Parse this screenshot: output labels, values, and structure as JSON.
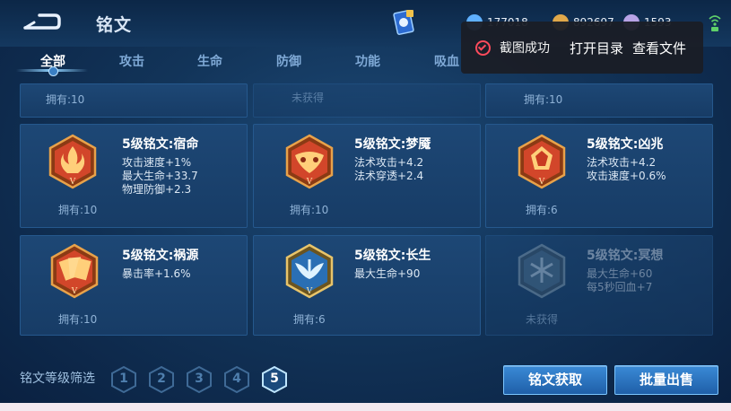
{
  "header": {
    "title": "铭文",
    "resources": [
      {
        "icon": "diamond-icon",
        "value": "177018",
        "color": "#5fb0ff"
      },
      {
        "icon": "gold-coin-icon",
        "value": "892697",
        "color": "#e0a84a"
      },
      {
        "icon": "crystal-icon",
        "value": "1593",
        "color": "#b8a3e6"
      }
    ]
  },
  "tabs": [
    "全部",
    "攻击",
    "生命",
    "防御",
    "功能",
    "吸血"
  ],
  "active_tab": "全部",
  "toast": {
    "message": "截图成功",
    "open_dir": "打开目录",
    "view_file": "查看文件"
  },
  "top_row": [
    {
      "owned": "拥有:10"
    },
    {
      "owned": "未获得"
    },
    {
      "owned": "拥有:10"
    }
  ],
  "cards": [
    {
      "name": "5级铭文:宿命",
      "attrs": [
        "攻击速度+1%",
        "最大生命+33.7",
        "物理防御+2.3"
      ],
      "owned": "拥有:10",
      "acquired": true,
      "color": "#d2462a",
      "icon": "flame-sigil-icon"
    },
    {
      "name": "5级铭文:梦魇",
      "attrs": [
        "法术攻击+4.2",
        "法术穿透+2.4"
      ],
      "owned": "拥有:10",
      "acquired": true,
      "color": "#d2462a",
      "icon": "mask-sigil-icon"
    },
    {
      "name": "5级铭文:凶兆",
      "attrs": [
        "法术攻击+4.2",
        "攻击速度+0.6%"
      ],
      "owned": "拥有:6",
      "acquired": true,
      "color": "#d2462a",
      "icon": "gem-sigil-icon"
    },
    {
      "name": "5级铭文:祸源",
      "attrs": [
        "暴击率+1.6%"
      ],
      "owned": "拥有:10",
      "acquired": true,
      "color": "#d2462a",
      "icon": "cards-sigil-icon"
    },
    {
      "name": "5级铭文:长生",
      "attrs": [
        "最大生命+90"
      ],
      "owned": "拥有:6",
      "acquired": true,
      "color": "#3b8fd0",
      "icon": "wings-sigil-icon"
    },
    {
      "name": "5级铭文:冥想",
      "attrs": [
        "最大生命+60",
        "每5秒回血+7"
      ],
      "owned": "未获得",
      "acquired": false,
      "color": "#4a6f90",
      "icon": "snowflake-sigil-icon"
    }
  ],
  "footer": {
    "filter_label": "铭文等级筛选",
    "levels": [
      "1",
      "2",
      "3",
      "4",
      "5"
    ],
    "active_level": "5",
    "acquire_button": "铭文获取",
    "bulk_sell_button": "批量出售"
  }
}
